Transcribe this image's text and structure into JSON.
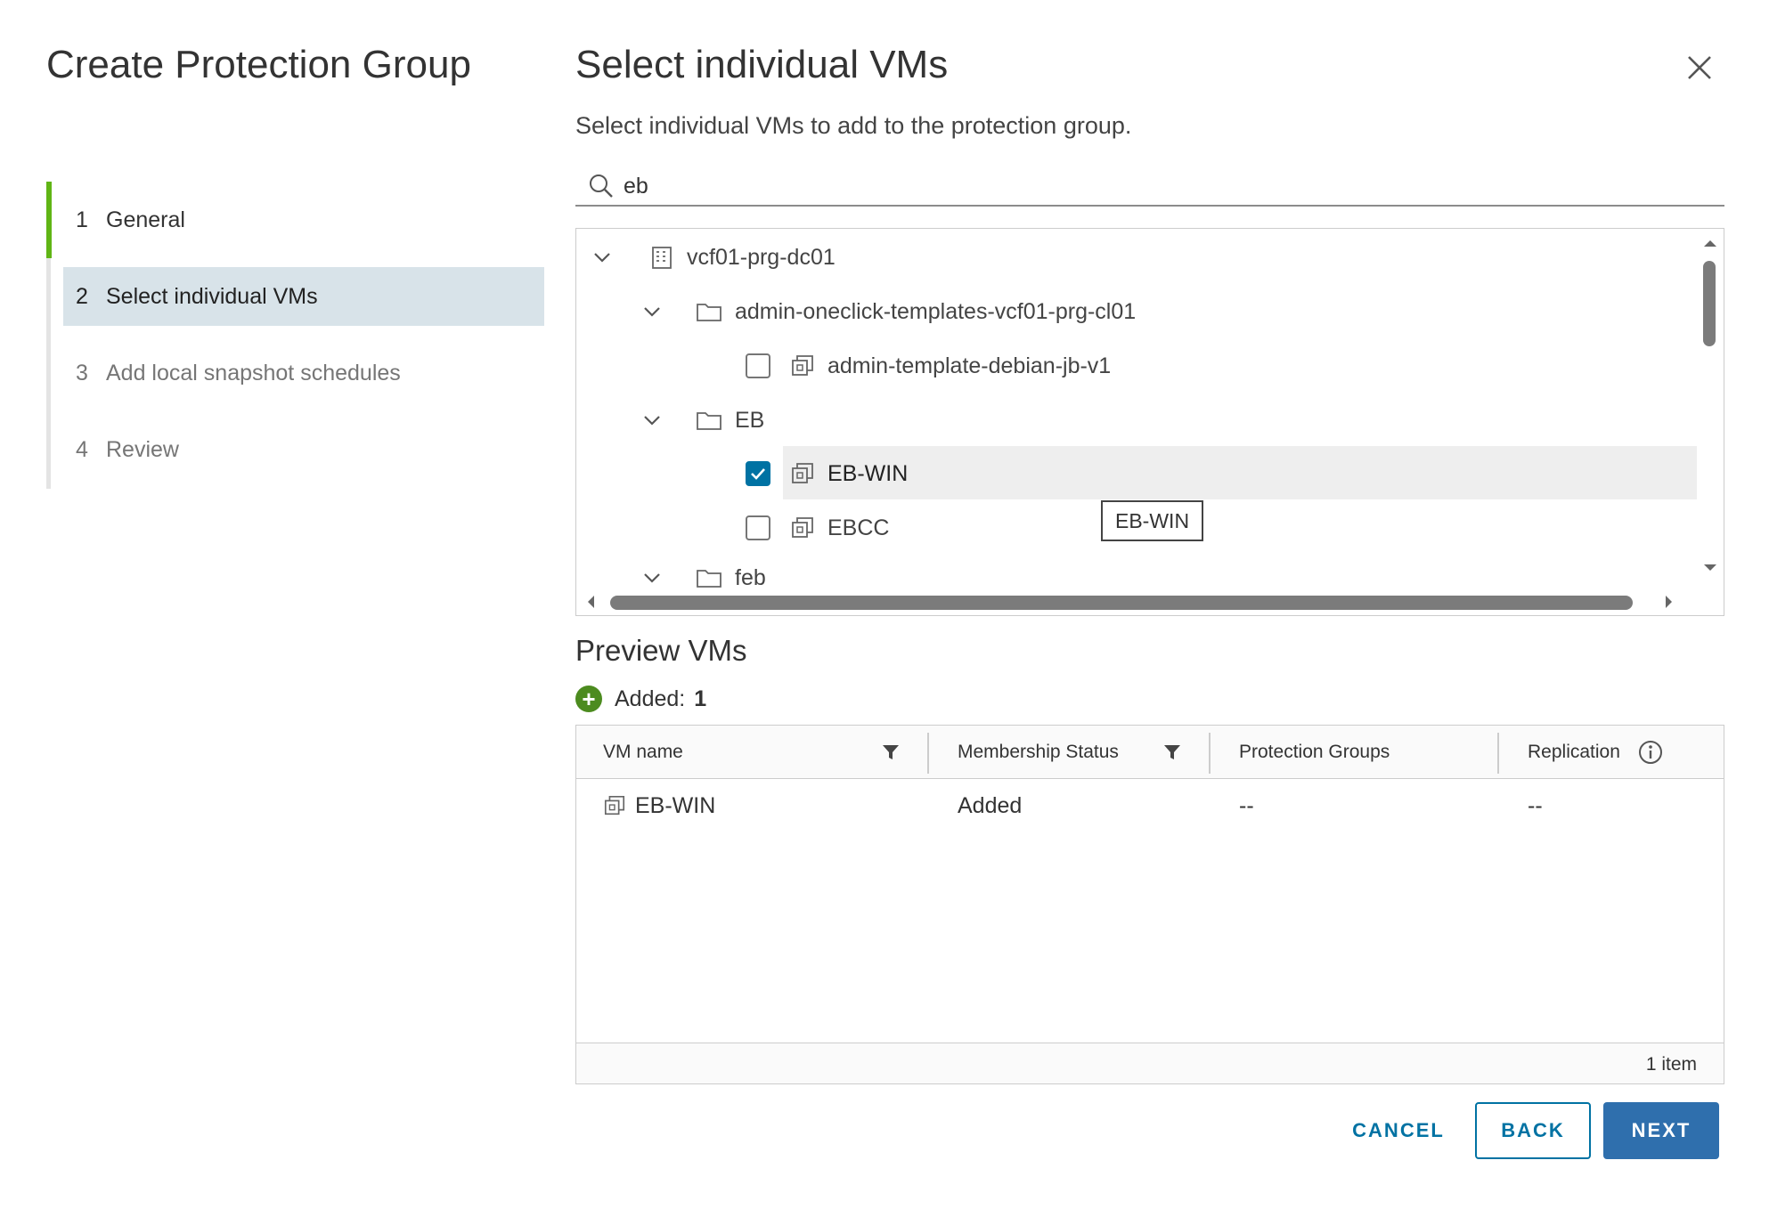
{
  "wizard": {
    "title": "Create Protection Group",
    "steps": [
      {
        "num": "1",
        "label": "General"
      },
      {
        "num": "2",
        "label": "Select individual VMs"
      },
      {
        "num": "3",
        "label": "Add local snapshot schedules"
      },
      {
        "num": "4",
        "label": "Review"
      }
    ]
  },
  "main": {
    "title": "Select individual VMs",
    "subtitle": "Select individual VMs to add to the protection group."
  },
  "search": {
    "value": "eb"
  },
  "tree": {
    "rows": [
      {
        "label": "vcf01-prg-dc01",
        "type": "datacenter",
        "expanded": true
      },
      {
        "label": "admin-oneclick-templates-vcf01-prg-cl01",
        "type": "folder",
        "expanded": true
      },
      {
        "label": "admin-template-debian-jb-v1",
        "type": "vm",
        "checked": false
      },
      {
        "label": "EB",
        "type": "folder",
        "expanded": true
      },
      {
        "label": "EB-WIN",
        "type": "vm",
        "checked": true
      },
      {
        "label": "EBCC",
        "type": "vm",
        "checked": false
      },
      {
        "label": "feb",
        "type": "folder",
        "expanded": true
      }
    ],
    "tooltip": "EB-WIN"
  },
  "preview": {
    "title": "Preview VMs",
    "added_label": "Added:",
    "added_count": "1",
    "columns": [
      "VM name",
      "Membership Status",
      "Protection Groups",
      "Replication"
    ],
    "rows": [
      {
        "vm_name": "EB-WIN",
        "membership_status": "Added",
        "protection_groups": "--",
        "replication": "--"
      }
    ],
    "footer": "1 item"
  },
  "buttons": {
    "cancel": "CANCEL",
    "back": "BACK",
    "next": "NEXT"
  },
  "colors": {
    "accent": "#0072a3",
    "primary_button": "#2f6fad",
    "step_active": "#60b515",
    "added_icon": "#4c8b1f"
  }
}
